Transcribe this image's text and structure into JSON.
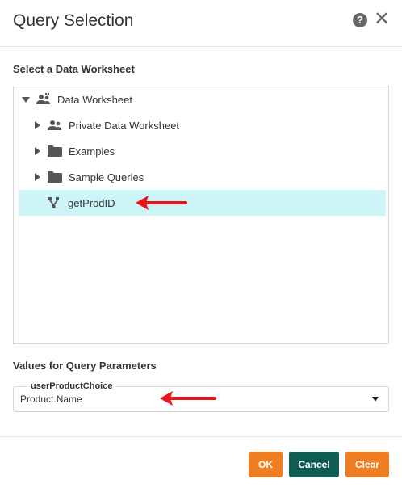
{
  "dialog": {
    "title": "Query Selection",
    "help_icon": "question-circle-icon",
    "close_icon": "close-icon"
  },
  "worksheet": {
    "label": "Select a Data Worksheet",
    "tree": {
      "root": {
        "label": "Data Worksheet",
        "icon": "shared-users-icon",
        "expanded": true
      },
      "children": [
        {
          "label": "Private Data Worksheet",
          "icon": "users-icon",
          "expanded": false
        },
        {
          "label": "Examples",
          "icon": "folder-icon",
          "expanded": false
        },
        {
          "label": "Sample Queries",
          "icon": "folder-icon",
          "expanded": false
        },
        {
          "label": "getProdID",
          "icon": "query-branch-icon",
          "selected": true
        }
      ]
    }
  },
  "params": {
    "label": "Values for Query Parameters",
    "field": {
      "legend": "userProductChoice",
      "value": "Product.Name"
    }
  },
  "footer": {
    "ok_label": "OK",
    "cancel_label": "Cancel",
    "clear_label": "Clear"
  },
  "colors": {
    "primary_orange": "#ef7d22",
    "cancel_teal": "#0f5d52",
    "selection": "#cdf4f6",
    "annotation_red": "#e8141b"
  }
}
